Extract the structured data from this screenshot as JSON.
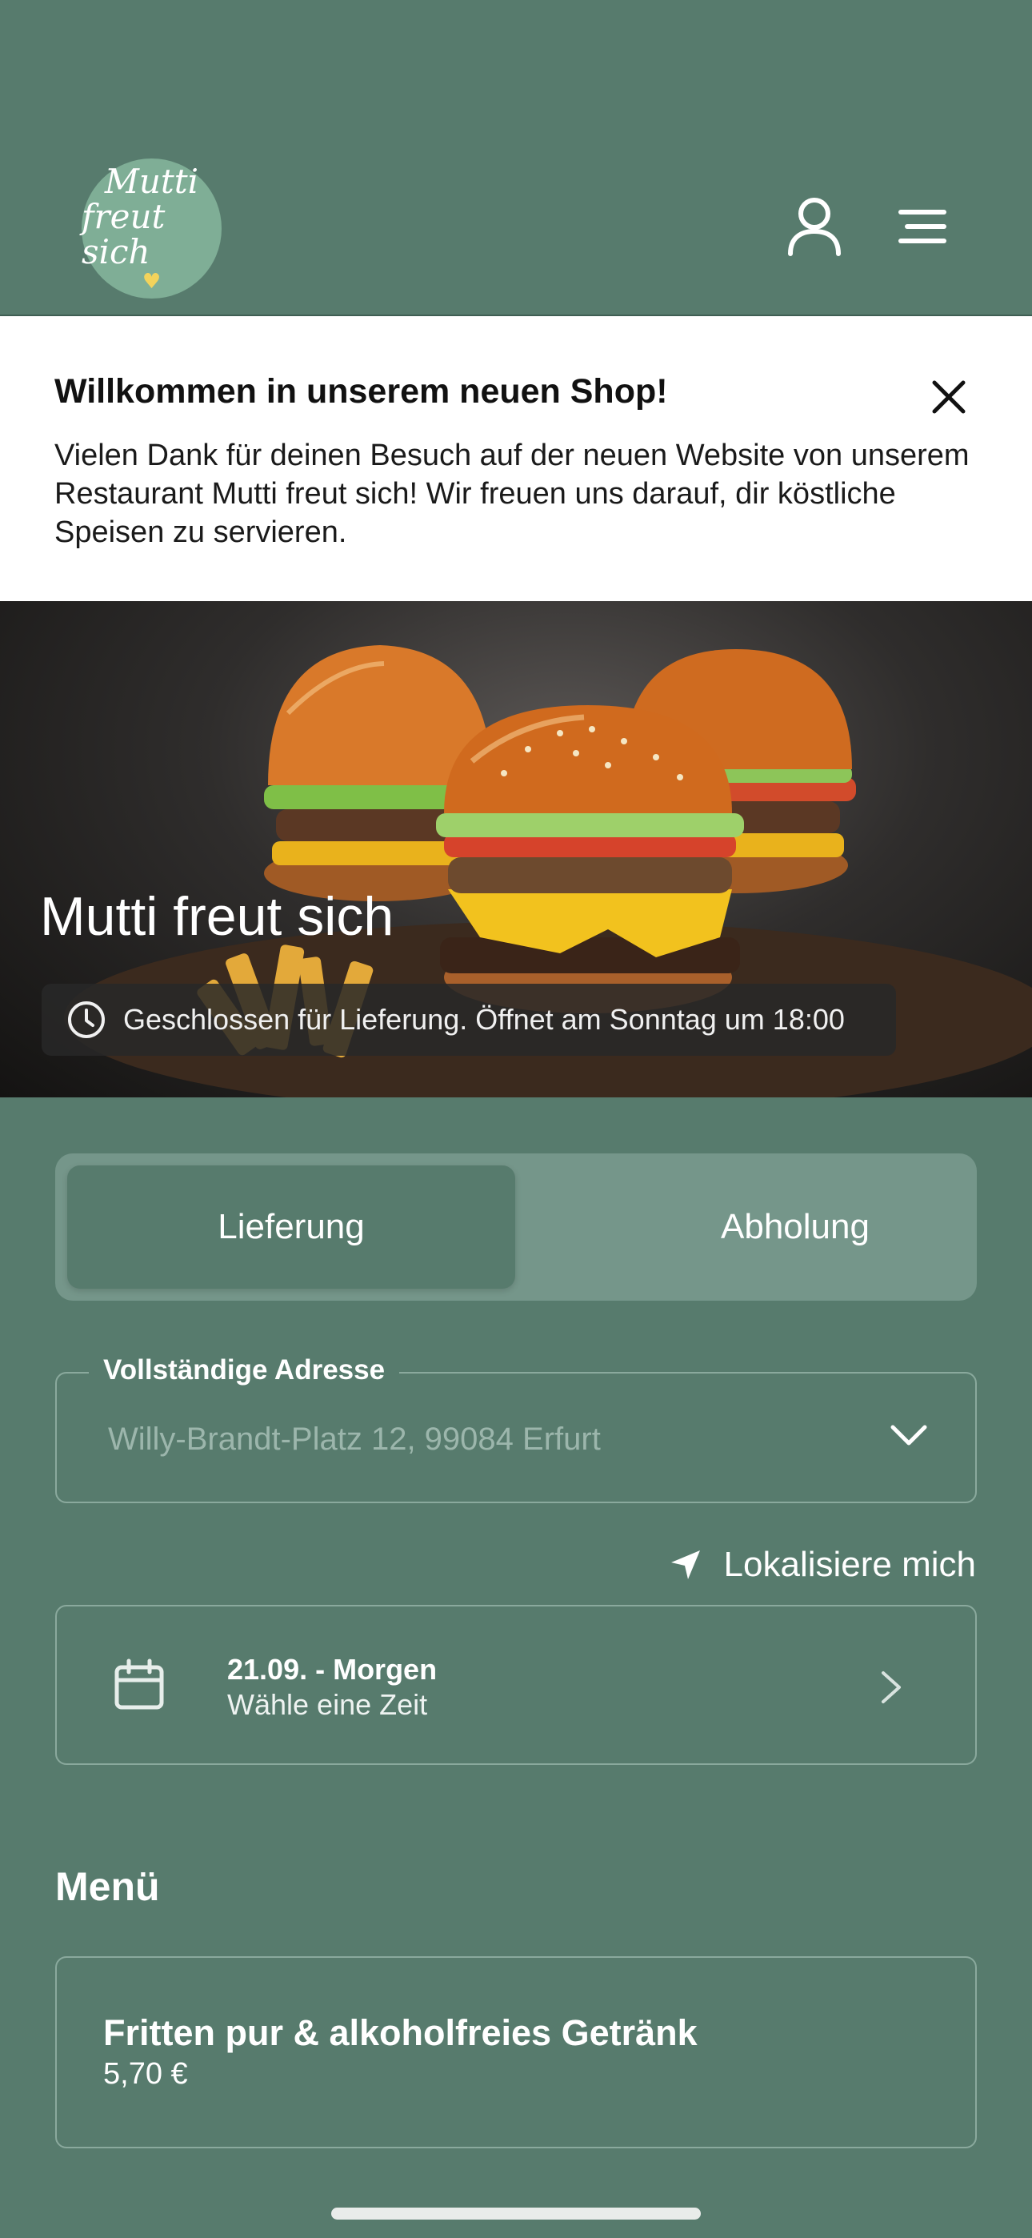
{
  "header": {
    "logo_line1": "Mutti",
    "logo_line2": "freut sich",
    "logo_heart": "♥",
    "user_icon": "user-icon",
    "menu_icon": "hamburger-menu-icon"
  },
  "banner": {
    "title": "Willkommen in unserem neuen Shop!",
    "text": "Vielen Dank für deinen Besuch auf der neuen Website von unserem Restaurant Mutti freut sich! Wir freuen uns darauf, dir köstliche Speisen zu servieren.",
    "close_icon": "close-icon"
  },
  "hero": {
    "title": "Mutti freut sich",
    "status": "Geschlossen für Lieferung. Öffnet am Sonntag um 18:00",
    "status_icon": "clock-icon"
  },
  "order_mode": {
    "options": [
      "Lieferung",
      "Abholung"
    ],
    "selected": "Lieferung"
  },
  "address": {
    "label": "Vollständige Adresse",
    "value": "Willy-Brandt-Platz 12, 99084 Erfurt"
  },
  "locate": {
    "label": "Lokalisiere mich",
    "icon": "location-arrow-icon"
  },
  "date": {
    "main": "21.09. - Morgen",
    "sub": "Wähle eine Zeit",
    "icon": "calendar-icon"
  },
  "menu": {
    "heading": "Menü",
    "items": [
      {
        "name": "Fritten pur & alkoholfreies Getränk",
        "price": "5,70 €"
      }
    ]
  },
  "colors": {
    "background": "#577b6d",
    "logo": "#7fae96",
    "toggle_bg": "#75968a",
    "banner": "#ffffff",
    "heart": "#f3d35b"
  }
}
